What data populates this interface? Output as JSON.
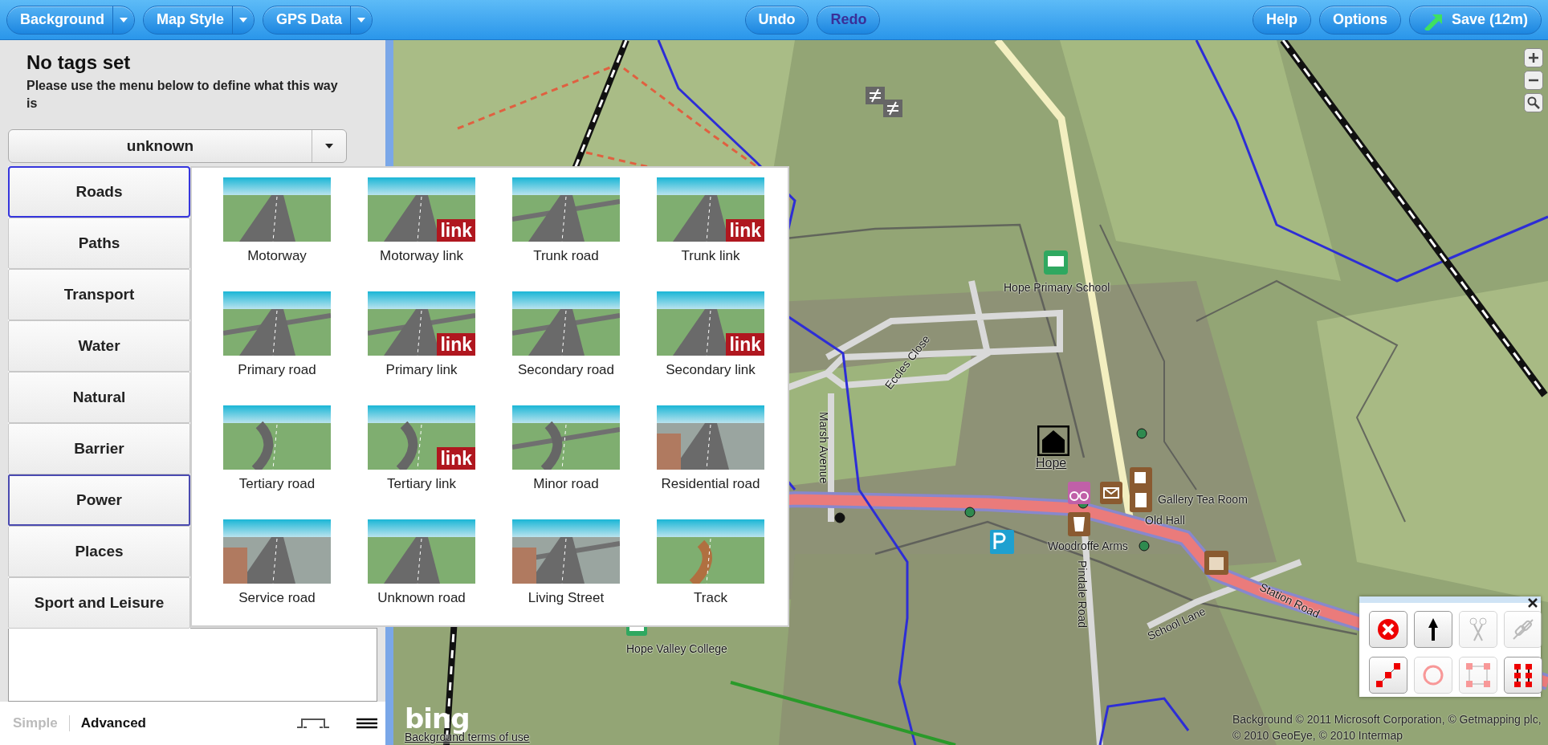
{
  "toolbar": {
    "left": [
      {
        "label": "Background",
        "dropdown": true
      },
      {
        "label": "Map Style",
        "dropdown": true
      },
      {
        "label": "GPS Data",
        "dropdown": true
      }
    ],
    "center": [
      {
        "label": "Undo",
        "disabled": false
      },
      {
        "label": "Redo",
        "disabled": true
      }
    ],
    "right": [
      {
        "label": "Help",
        "kind": "plain"
      },
      {
        "label": "Options",
        "kind": "plain"
      },
      {
        "label": "Save (12m)",
        "kind": "save"
      }
    ]
  },
  "sidebar": {
    "title": "No tags set",
    "description": "Please use the menu below to define what this way is",
    "type_select": {
      "value": "unknown"
    },
    "categories": [
      {
        "label": "Roads",
        "selected": true,
        "hovered": false
      },
      {
        "label": "Paths",
        "selected": false,
        "hovered": false
      },
      {
        "label": "Transport",
        "selected": false,
        "hovered": false
      },
      {
        "label": "Water",
        "selected": false,
        "hovered": false
      },
      {
        "label": "Natural",
        "selected": false,
        "hovered": false
      },
      {
        "label": "Barrier",
        "selected": false,
        "hovered": false
      },
      {
        "label": "Power",
        "selected": false,
        "hovered": true
      },
      {
        "label": "Places",
        "selected": false,
        "hovered": false
      },
      {
        "label": "Sport and Leisure",
        "selected": false,
        "hovered": false
      }
    ],
    "presets": [
      {
        "label": "Motorway"
      },
      {
        "label": "Motorway link",
        "badge": "link"
      },
      {
        "label": "Trunk road"
      },
      {
        "label": "Trunk link",
        "badge": "link"
      },
      {
        "label": "Primary road"
      },
      {
        "label": "Primary link",
        "badge": "link"
      },
      {
        "label": "Secondary road"
      },
      {
        "label": "Secondary link",
        "badge": "link"
      },
      {
        "label": "Tertiary road"
      },
      {
        "label": "Tertiary link",
        "badge": "link"
      },
      {
        "label": "Minor road"
      },
      {
        "label": "Residential road"
      },
      {
        "label": "Service road"
      },
      {
        "label": "Unknown road"
      },
      {
        "label": "Living Street"
      },
      {
        "label": "Track"
      }
    ],
    "modes": [
      {
        "label": "Simple",
        "selected": false
      },
      {
        "label": "Advanced",
        "selected": true
      }
    ]
  },
  "map": {
    "labels": [
      "Hope Primary School",
      "Hope",
      "Gallery Tea Room",
      "Old Hall",
      "Woodroffe Arms",
      "Marsh Avenue",
      "Eccles Close",
      "Pindale Road",
      "School Lane",
      "Station Road",
      "Hope Valley College"
    ],
    "logo": "bing",
    "terms_link": "Background terms of use",
    "attribution": "Background © 2011 Microsoft Corporation, © Getmapping plc, © 2010 GeoEye, © 2010 Intermap",
    "tools": [
      {
        "enabled": true
      },
      {
        "enabled": true
      },
      {
        "enabled": false
      },
      {
        "enabled": false
      },
      {
        "enabled": true
      },
      {
        "enabled": false
      },
      {
        "enabled": false
      },
      {
        "enabled": true
      }
    ]
  }
}
